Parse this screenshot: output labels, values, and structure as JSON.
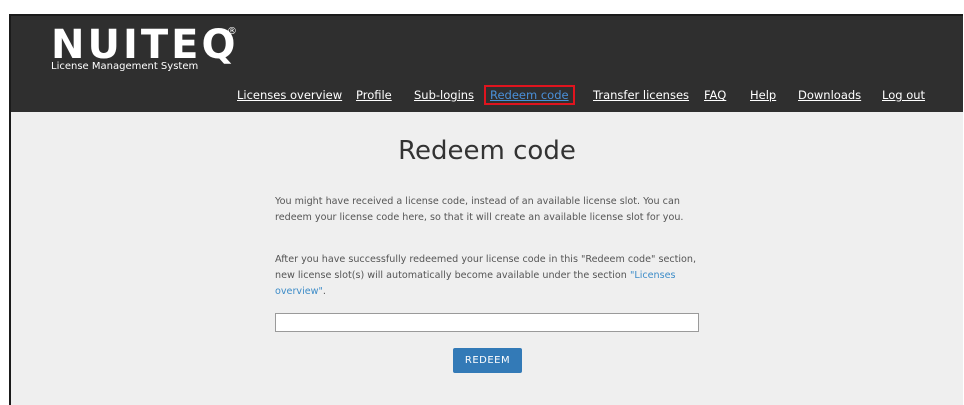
{
  "brand": {
    "logo": "NUITEQ",
    "registered": "®",
    "subtitle": "License Management System"
  },
  "nav": {
    "items": [
      {
        "label": "Licenses overview",
        "active": false
      },
      {
        "label": "Profile",
        "active": false
      },
      {
        "label": "Sub-logins",
        "active": false
      },
      {
        "label": "Redeem code",
        "active": true
      },
      {
        "label": "Transfer licenses",
        "active": false
      },
      {
        "label": "FAQ",
        "active": false
      },
      {
        "label": "Help",
        "active": false
      },
      {
        "label": "Downloads",
        "active": false
      },
      {
        "label": "Log out",
        "active": false
      }
    ]
  },
  "main": {
    "title": "Redeem code",
    "intro": "You might have received a license code, instead of an available license slot. You can redeem your license code here, so that it will create an available license slot for you.",
    "after_text": "After you have successfully redeemed your license code in this \"Redeem code\" section, new license slot(s) will automatically become available under the section ",
    "after_link": "\"Licenses overview\"",
    "after_end": ".",
    "code_input": {
      "value": "",
      "placeholder": ""
    },
    "redeem_button": "REDEEM"
  },
  "colors": {
    "header_bg": "#2f2f2f",
    "content_bg": "#efefef",
    "button_bg": "#337ab7",
    "link": "#3d8cc8",
    "active_outline": "#e0141e"
  }
}
